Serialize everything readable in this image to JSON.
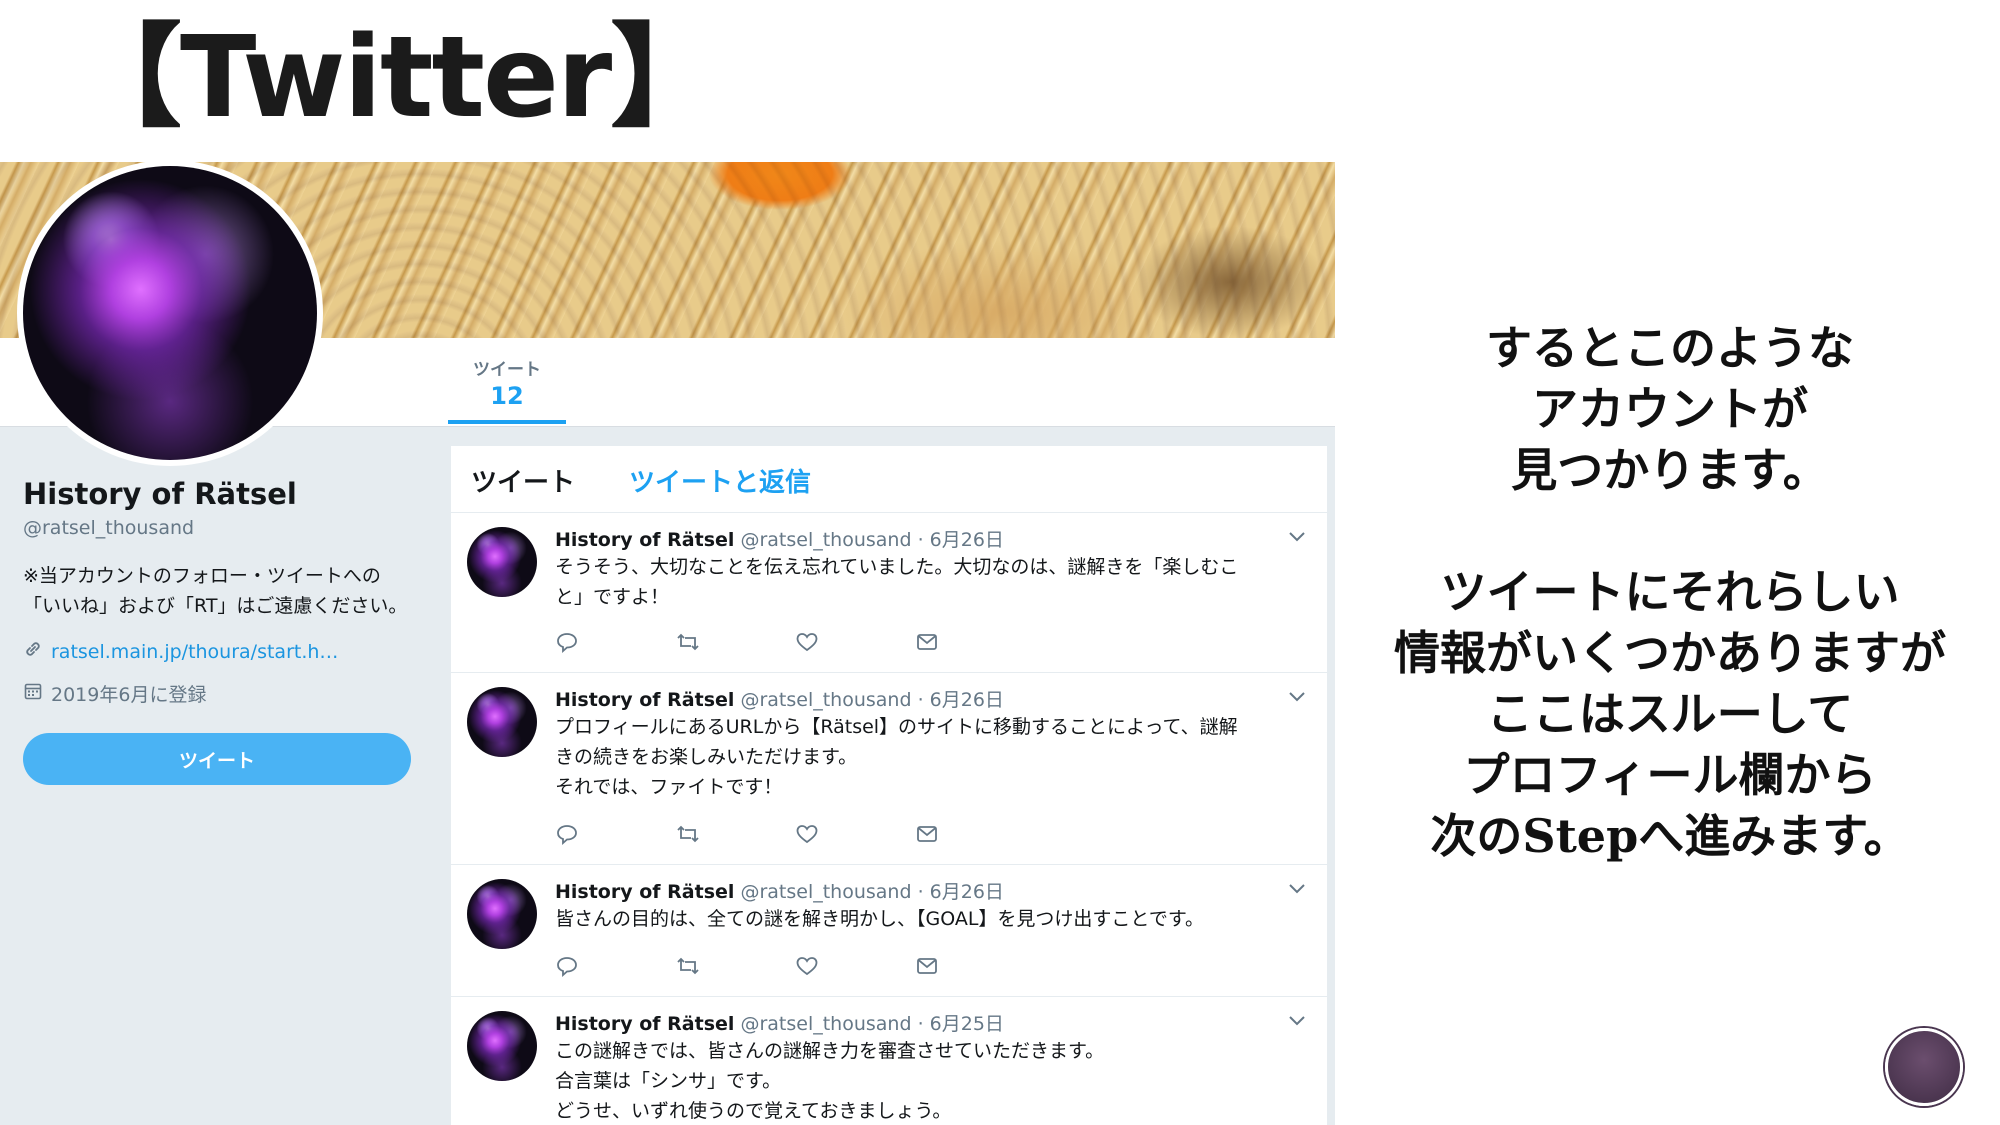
{
  "slide": {
    "title": "【Twitter】",
    "explanation": [
      "するとこのような",
      "アカウントが",
      "見つかります。",
      "",
      "ツイートにそれらしい",
      "情報がいくつかありますが",
      "ここはスルーして",
      "プロフィール欄から",
      "次のStepへ進みます。"
    ]
  },
  "nav": {
    "tweets_label": "ツイート",
    "tweets_count": "12"
  },
  "profile": {
    "name": "History of Rätsel",
    "handle": "@ratsel_thousand",
    "bio": "※当アカウントのフォロー・ツイートへの「いいね」および「RT」はご遠慮ください。",
    "url": "ratsel.main.jp/thoura/start.h…",
    "joined": "2019年6月に登録",
    "tweet_button": "ツイート"
  },
  "timeline": {
    "tab_tweets": "ツイート",
    "tab_replies": "ツイートと返信",
    "tweets": [
      {
        "name": "History of Rätsel",
        "meta": "@ratsel_thousand · 6月26日",
        "lines": [
          "そうそう、大切なことを伝え忘れていました。大切なのは、謎解きを「楽しむこ",
          "と」ですよ！"
        ]
      },
      {
        "name": "History of Rätsel",
        "meta": "@ratsel_thousand · 6月26日",
        "lines": [
          "プロフィールにあるURLから【Rätsel】のサイトに移動することによって、謎解",
          "きの続きをお楽しみいただけます。",
          "それでは、ファイトです！"
        ]
      },
      {
        "name": "History of Rätsel",
        "meta": "@ratsel_thousand · 6月26日",
        "lines": [
          "皆さんの目的は、全ての謎を解き明かし、【GOAL】を見つけ出すことです。"
        ]
      },
      {
        "name": "History of Rätsel",
        "meta": "@ratsel_thousand · 6月25日",
        "lines": [
          "この謎解きでは、皆さんの謎解き力を審査させていただきます。",
          "合言葉は「シンサ」です。",
          "どうせ、いずれ使うので覚えておきましょう。"
        ]
      }
    ]
  },
  "colors": {
    "accent": "#1da1f2",
    "button": "#4ab3f4",
    "link": "#1b95e0",
    "muted": "#657786"
  }
}
